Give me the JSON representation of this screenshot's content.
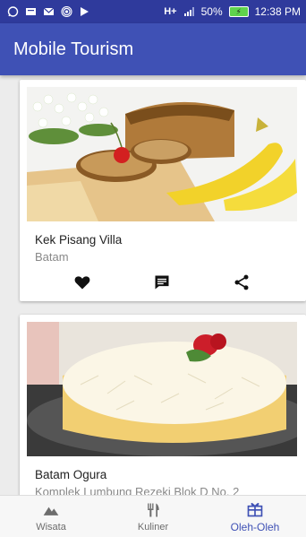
{
  "status_bar": {
    "battery_percent": "50%",
    "time": "12:38 PM",
    "network_label": "H+"
  },
  "app_bar": {
    "title": "Mobile Tourism"
  },
  "cards": [
    {
      "title": "Kek Pisang Villa",
      "subtitle": "Batam",
      "image_icon": "banana-cake-photo",
      "actions": [
        "heart-icon",
        "comment-icon",
        "share-icon"
      ]
    },
    {
      "title": "Batam Ogura",
      "subtitle": "Komplek Lumbung Rezeki Blok D No. 2",
      "image_icon": "cheese-cake-photo"
    }
  ],
  "bottom_nav": {
    "items": [
      {
        "label": "Wisata",
        "icon": "mountain-icon",
        "active": false
      },
      {
        "label": "Kuliner",
        "icon": "fork-knife-icon",
        "active": false
      },
      {
        "label": "Oleh-Oleh",
        "icon": "gift-box-icon",
        "active": true
      }
    ]
  },
  "colors": {
    "primary": "#3f51b5",
    "primary_dark": "#2f3a9c",
    "background": "#ececec"
  }
}
